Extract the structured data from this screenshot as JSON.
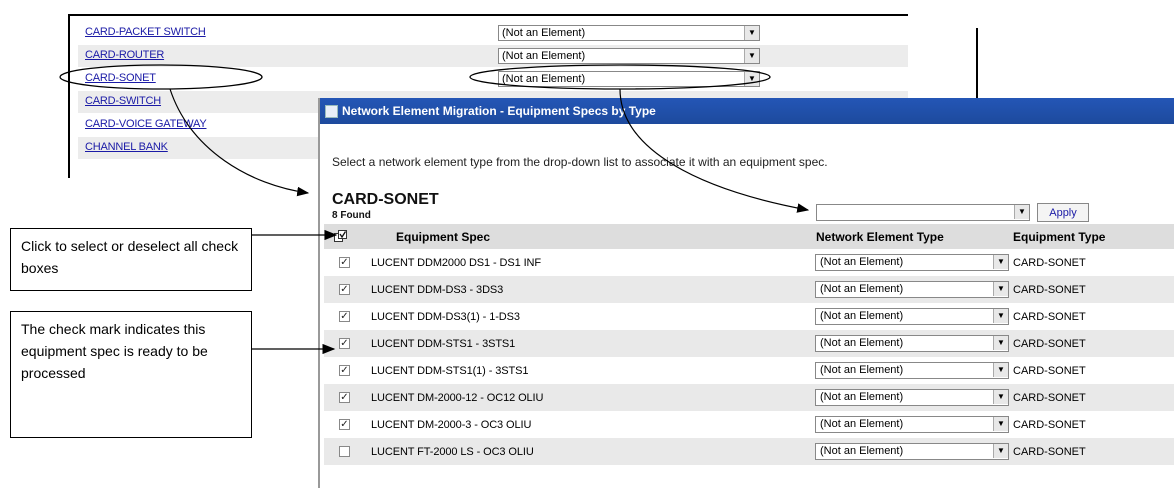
{
  "type_list": {
    "rows": [
      {
        "label": "CARD-PACKET SWITCH",
        "value": "(Not an Element)"
      },
      {
        "label": "CARD-ROUTER",
        "value": "(Not an Element)"
      },
      {
        "label": "CARD-SONET",
        "value": "(Not an Element)"
      },
      {
        "label": "CARD-SWITCH",
        "value": ""
      },
      {
        "label": "CARD-VOICE GATEWAY",
        "value": ""
      },
      {
        "label": "CHANNEL BANK",
        "value": ""
      }
    ]
  },
  "window": {
    "title": "Network Element Migration - Equipment Specs by Type",
    "instruction": "Select a network element type from the drop-down list to associate it with an equipment spec.",
    "section_title": "CARD-SONET",
    "found": "8 Found",
    "apply_label": "Apply",
    "columns": {
      "spec": "Equipment Spec",
      "net_type": "Network Element Type",
      "eq_type": "Equipment Type"
    },
    "rows": [
      {
        "spec": "LUCENT DDM2000 DS1 - DS1 INF",
        "checked": "✓",
        "net_type": "(Not an Element)",
        "eq_type": "CARD-SONET"
      },
      {
        "spec": "LUCENT DDM-DS3 - 3DS3",
        "checked": "✓",
        "net_type": "(Not an Element)",
        "eq_type": "CARD-SONET"
      },
      {
        "spec": "LUCENT DDM-DS3(1) - 1-DS3",
        "checked": "✓",
        "net_type": "(Not an Element)",
        "eq_type": "CARD-SONET"
      },
      {
        "spec": "LUCENT DDM-STS1 - 3STS1",
        "checked": "✓",
        "net_type": "(Not an Element)",
        "eq_type": "CARD-SONET"
      },
      {
        "spec": "LUCENT DDM-STS1(1) - 3STS1",
        "checked": "✓",
        "net_type": "(Not an Element)",
        "eq_type": "CARD-SONET"
      },
      {
        "spec": "LUCENT DM-2000-12 - OC12 OLIU",
        "checked": "✓",
        "net_type": "(Not an Element)",
        "eq_type": "CARD-SONET"
      },
      {
        "spec": "LUCENT DM-2000-3 - OC3 OLIU",
        "checked": "✓",
        "net_type": "(Not an Element)",
        "eq_type": "CARD-SONET"
      },
      {
        "spec": "LUCENT FT-2000 LS - OC3 OLIU",
        "checked": "",
        "net_type": "(Not an Element)",
        "eq_type": "CARD-SONET"
      }
    ]
  },
  "callouts": {
    "select_all": "Click to select or deselect all check boxes",
    "check_mark": "The check mark indicates this equipment spec is ready to be processed"
  }
}
